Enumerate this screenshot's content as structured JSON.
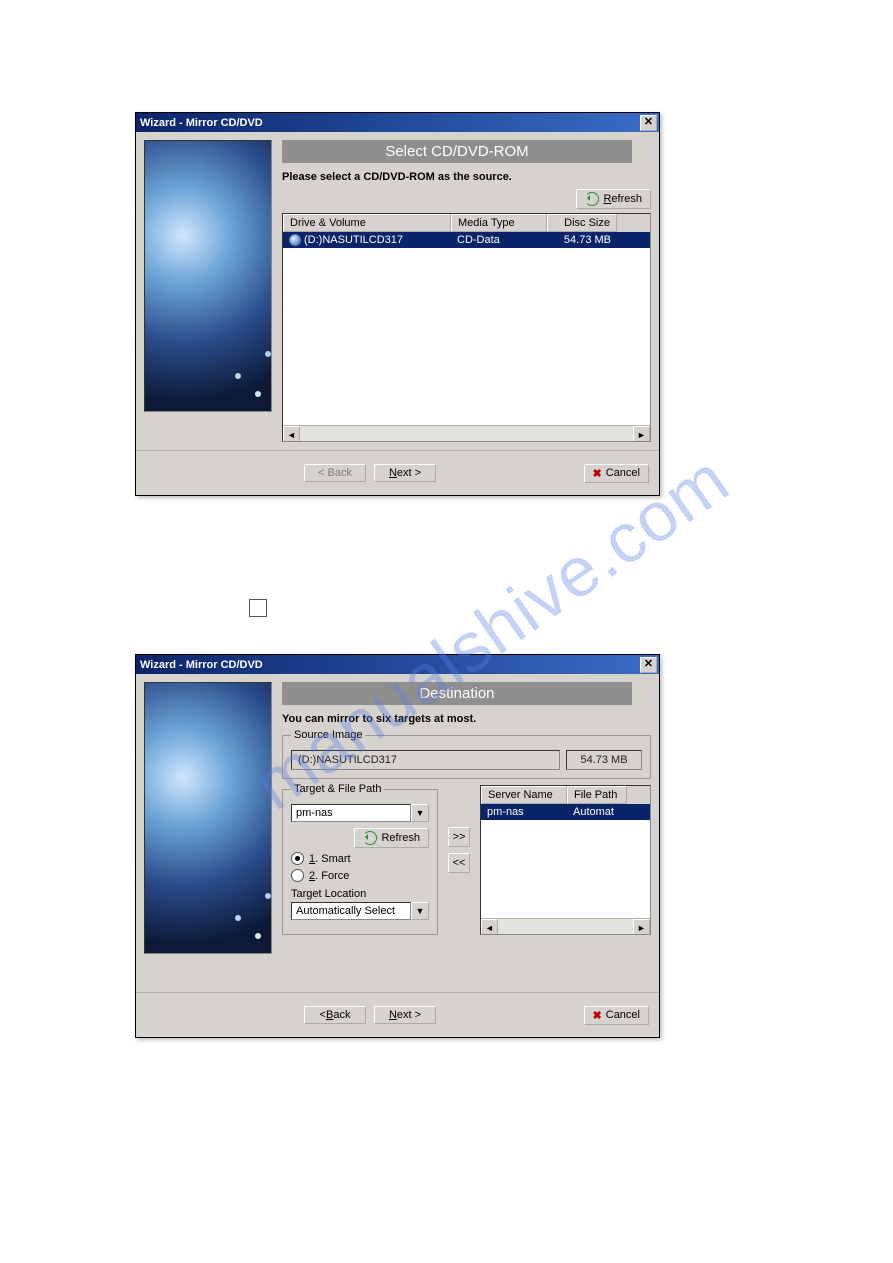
{
  "watermark": "manualshive.com",
  "dialog1": {
    "title": "Wizard - Mirror CD/DVD",
    "banner": "Select  CD/DVD-ROM",
    "instruction": "Please select a CD/DVD-ROM as the source.",
    "refresh_label": "Refresh",
    "columns": {
      "drive": "Drive & Volume",
      "media": "Media Type",
      "size": "Disc Size"
    },
    "row": {
      "drive": "(D:)NASUTILCD317",
      "media": "CD-Data",
      "size": "54.73 MB"
    },
    "buttons": {
      "back": "< Back",
      "next": "Next >",
      "cancel": "Cancel"
    }
  },
  "dialog2": {
    "title": "Wizard - Mirror CD/DVD",
    "banner": "Destination",
    "instruction": "You can mirror to six targets at most.",
    "source_legend": "Source Image",
    "source_value": "(D:)NASUTILCD317",
    "source_size": "54.73 MB",
    "target_legend": "Target & File Path",
    "target_combo": "pm-nas",
    "refresh_label": "Refresh",
    "radio_smart": "1. Smart",
    "radio_force": "2. Force",
    "target_location_label": "Target Location",
    "target_location_value": "Automatically Select",
    "add_btn": ">>",
    "remove_btn": "<<",
    "list_columns": {
      "server": "Server Name",
      "filepath": "File Path"
    },
    "list_row": {
      "server": "pm-nas",
      "filepath": "Automat"
    },
    "buttons": {
      "back": "< Back",
      "next": "Next >",
      "cancel": "Cancel"
    }
  }
}
